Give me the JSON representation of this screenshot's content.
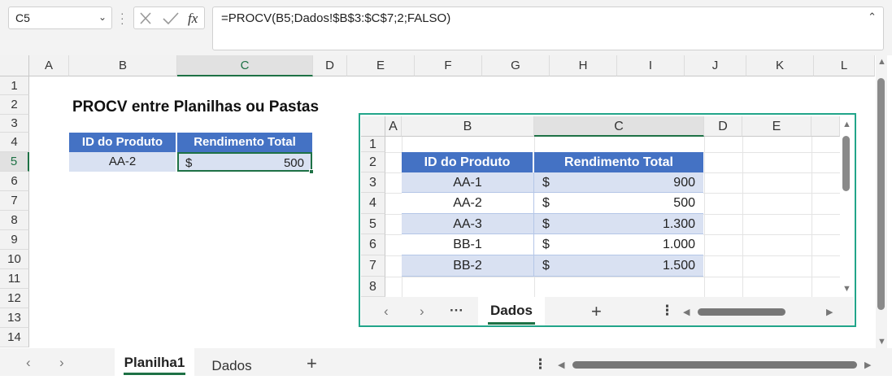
{
  "formula_bar": {
    "name_box": "C5",
    "formula": "=PROCV(B5;Dados!$B$3:$C$7;2;FALSO)",
    "fx_label": "fx"
  },
  "main_sheet": {
    "columns": [
      "A",
      "B",
      "C",
      "D",
      "E",
      "F",
      "G",
      "H",
      "I",
      "J",
      "K",
      "L"
    ],
    "rows": [
      "1",
      "2",
      "3",
      "4",
      "5",
      "6",
      "7",
      "8",
      "9",
      "10",
      "11",
      "12",
      "13",
      "14"
    ],
    "title": "PROCV entre Planilhas ou Pastas",
    "table_headers": [
      "ID do Produto",
      "Rendimento Total"
    ],
    "lookup_row": {
      "id": "AA-2",
      "currency": "$",
      "value": "500"
    }
  },
  "embedded_sheet": {
    "columns": [
      "A",
      "B",
      "C",
      "D",
      "E"
    ],
    "rows": [
      "1",
      "2",
      "3",
      "4",
      "5",
      "6",
      "7",
      "8"
    ],
    "table_headers": [
      "ID do Produto",
      "Rendimento Total"
    ],
    "table_rows": [
      {
        "id": "AA-1",
        "currency": "$",
        "value": "900"
      },
      {
        "id": "AA-2",
        "currency": "$",
        "value": "500"
      },
      {
        "id": "AA-3",
        "currency": "$",
        "value": "1.300"
      },
      {
        "id": "BB-1",
        "currency": "$",
        "value": "1.000"
      },
      {
        "id": "BB-2",
        "currency": "$",
        "value": "1.500"
      }
    ],
    "active_tab": "Dados"
  },
  "sheet_tabs": {
    "active": "Planilha1",
    "other": "Dados"
  },
  "colors": {
    "header_blue": "#4472c4",
    "row_light": "#d9e1f2",
    "selection_green": "#1e7145",
    "panel_border": "#22a58a"
  }
}
